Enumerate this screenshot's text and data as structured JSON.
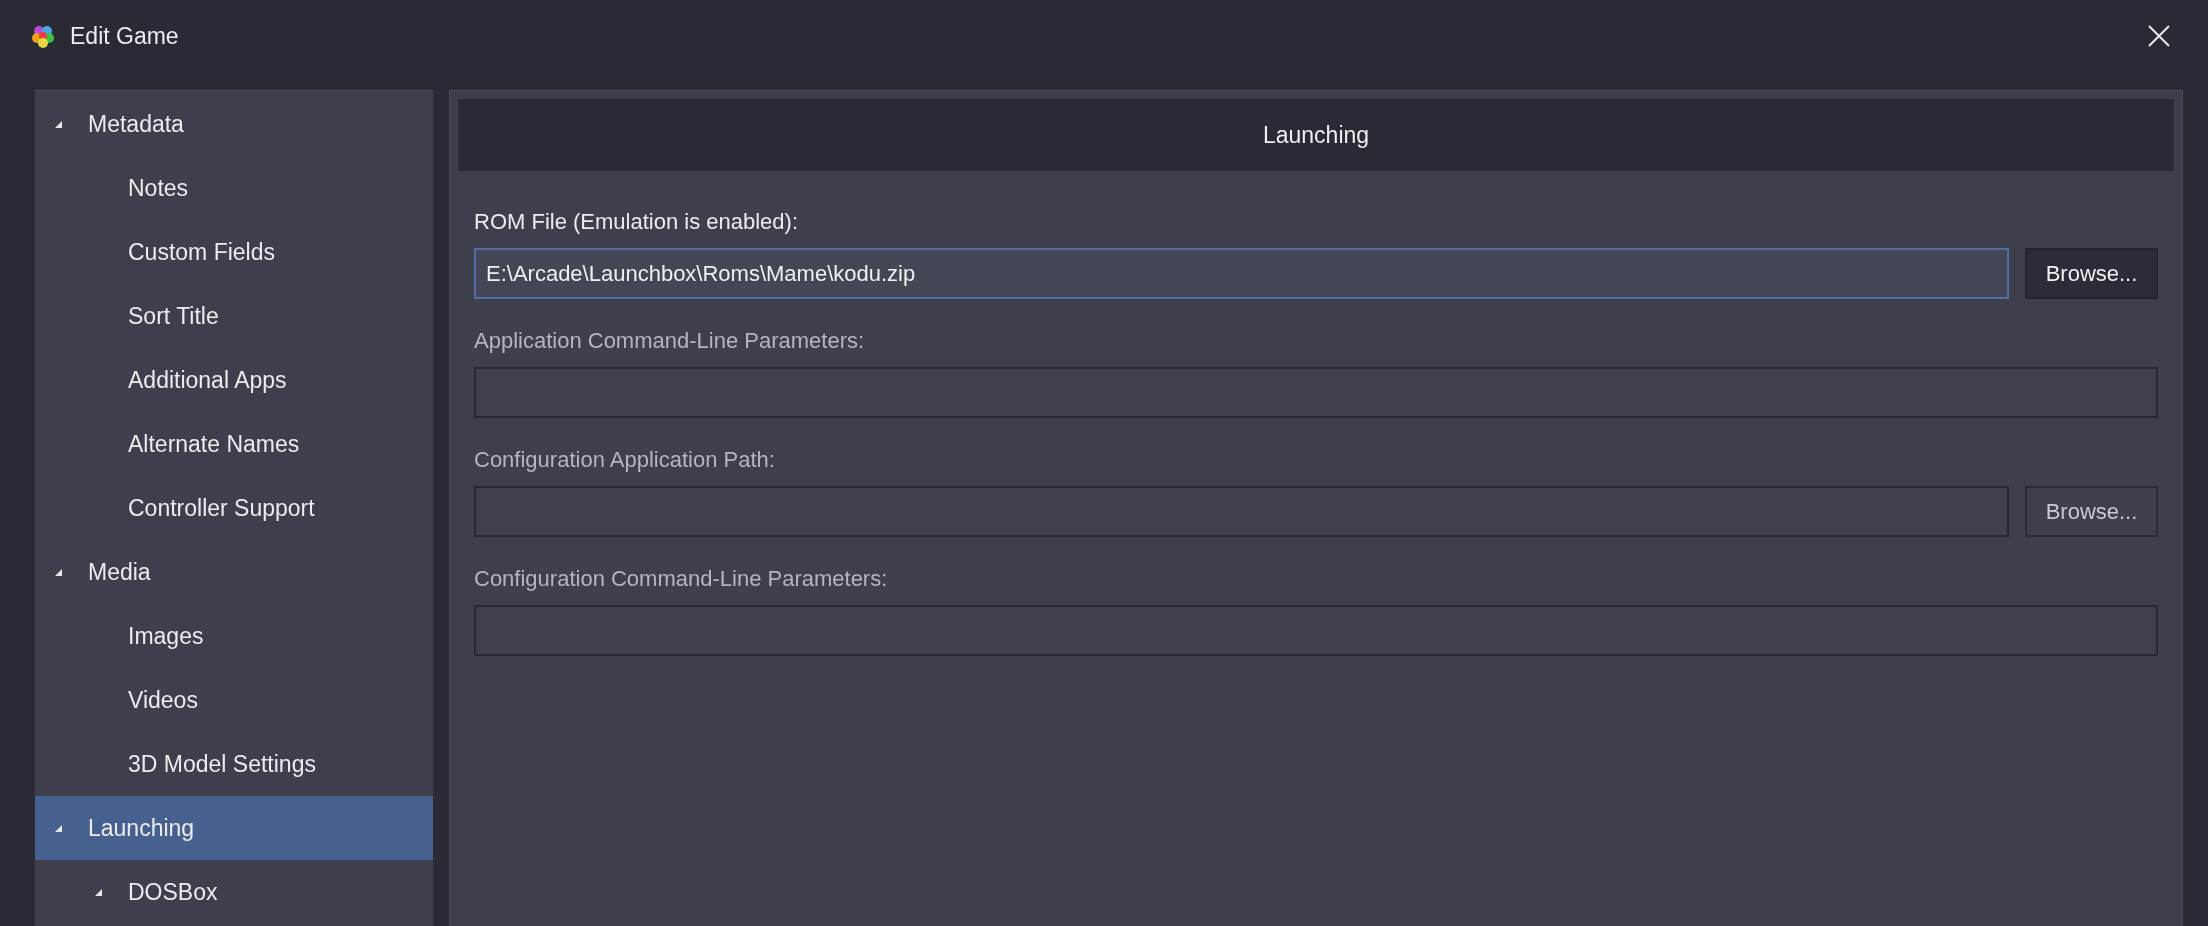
{
  "window": {
    "title": "Edit Game"
  },
  "sidebar": {
    "items": [
      {
        "label": "Metadata",
        "selected": false,
        "expanded": true,
        "children": [
          {
            "label": "Notes",
            "selected": false
          },
          {
            "label": "Custom Fields",
            "selected": false
          },
          {
            "label": "Sort Title",
            "selected": false
          },
          {
            "label": "Additional Apps",
            "selected": false
          },
          {
            "label": "Alternate Names",
            "selected": false
          },
          {
            "label": "Controller Support",
            "selected": false
          }
        ]
      },
      {
        "label": "Media",
        "selected": false,
        "expanded": true,
        "children": [
          {
            "label": "Images",
            "selected": false
          },
          {
            "label": "Videos",
            "selected": false
          },
          {
            "label": "3D Model Settings",
            "selected": false
          }
        ]
      },
      {
        "label": "Launching",
        "selected": true,
        "expanded": true,
        "children": [
          {
            "label": "DOSBox",
            "selected": false,
            "expanded": true
          }
        ]
      }
    ]
  },
  "panel": {
    "title": "Launching",
    "fields": [
      {
        "label": "ROM File (Emulation is enabled):",
        "value": "E:\\Arcade\\Launchbox\\Roms\\Mame\\kodu.zip",
        "focused": true,
        "disabled": false,
        "button": "Browse..."
      },
      {
        "label": "Application Command-Line Parameters:",
        "focused": false,
        "disabled": true
      },
      {
        "label": "Configuration Application Path:",
        "focused": false,
        "disabled": true,
        "button": "Browse..."
      },
      {
        "label": "Configuration Command-Line Parameters:",
        "focused": false,
        "disabled": true
      }
    ]
  }
}
